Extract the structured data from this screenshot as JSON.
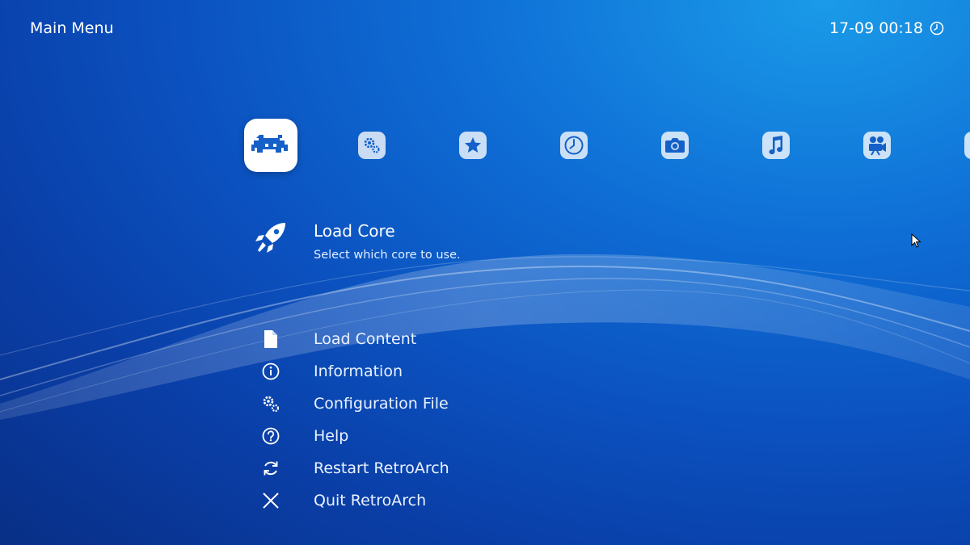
{
  "header": {
    "title": "Main Menu",
    "datetime": "17-09 00:18",
    "clock_icon": "clock-icon"
  },
  "tabs": [
    {
      "name": "main-menu",
      "icon": "retroarch-invader-icon",
      "active": true
    },
    {
      "name": "settings",
      "icon": "settings-gear-icon"
    },
    {
      "name": "favorites",
      "icon": "star-icon"
    },
    {
      "name": "history",
      "icon": "history-clock-icon"
    },
    {
      "name": "images",
      "icon": "camera-icon"
    },
    {
      "name": "music",
      "icon": "music-note-icon"
    },
    {
      "name": "video",
      "icon": "video-camera-icon"
    },
    {
      "name": "more",
      "icon": "partial-tab-icon"
    }
  ],
  "menu": {
    "selected": {
      "label": "Load Core",
      "sublabel": "Select which core to use.",
      "icon": "rocket-icon"
    },
    "items": [
      {
        "label": "Load Content",
        "icon": "file-icon"
      },
      {
        "label": "Information",
        "icon": "info-icon"
      },
      {
        "label": "Configuration File",
        "icon": "gears-icon"
      },
      {
        "label": "Help",
        "icon": "help-icon"
      },
      {
        "label": "Restart RetroArch",
        "icon": "restart-icon"
      },
      {
        "label": "Quit RetroArch",
        "icon": "close-icon"
      }
    ]
  },
  "colors": {
    "background_top": "#1a9be8",
    "background_bottom": "#082f86",
    "tab_active": "#ffffff",
    "tab_inactive": "#c8dcf5",
    "icon_blue": "#1560c8"
  }
}
